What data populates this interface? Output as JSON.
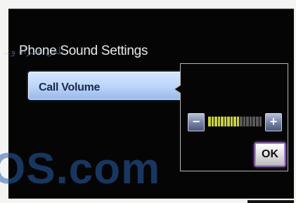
{
  "screen": {
    "title": "Phone Sound Settings",
    "selected_item": "Call Volume"
  },
  "volume_popup": {
    "decrease_label": "−",
    "increase_label": "+",
    "level": 10,
    "max_level": 17,
    "colors": {
      "active": "#c9d142",
      "inactive": "#5a5a5a"
    },
    "ok_label": "OK"
  },
  "watermark": {
    "arabic_text": "تلفن همراه و...",
    "url_text": "OS.com"
  }
}
